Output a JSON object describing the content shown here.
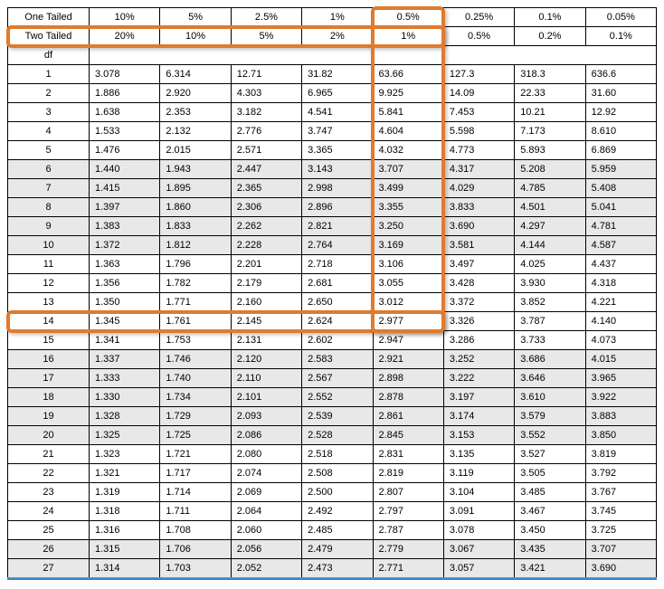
{
  "headers": {
    "one_tailed_label": "One Tailed",
    "two_tailed_label": "Two Tailed",
    "df_label": "df",
    "one_tailed": [
      "10%",
      "5%",
      "2.5%",
      "1%",
      "0.5%",
      "0.25%",
      "0.1%",
      "0.05%"
    ],
    "two_tailed": [
      "20%",
      "10%",
      "5%",
      "2%",
      "1%",
      "0.5%",
      "0.2%",
      "0.1%"
    ]
  },
  "rows": [
    {
      "df": "1",
      "v": [
        "3.078",
        "6.314",
        "12.71",
        "31.82",
        "63.66",
        "127.3",
        "318.3",
        "636.6"
      ]
    },
    {
      "df": "2",
      "v": [
        "1.886",
        "2.920",
        "4.303",
        "6.965",
        "9.925",
        "14.09",
        "22.33",
        "31.60"
      ]
    },
    {
      "df": "3",
      "v": [
        "1.638",
        "2.353",
        "3.182",
        "4.541",
        "5.841",
        "7.453",
        "10.21",
        "12.92"
      ]
    },
    {
      "df": "4",
      "v": [
        "1.533",
        "2.132",
        "2.776",
        "3.747",
        "4.604",
        "5.598",
        "7.173",
        "8.610"
      ]
    },
    {
      "df": "5",
      "v": [
        "1.476",
        "2.015",
        "2.571",
        "3.365",
        "4.032",
        "4.773",
        "5.893",
        "6.869"
      ]
    },
    {
      "df": "6",
      "v": [
        "1.440",
        "1.943",
        "2.447",
        "3.143",
        "3.707",
        "4.317",
        "5.208",
        "5.959"
      ],
      "shaded": true
    },
    {
      "df": "7",
      "v": [
        "1.415",
        "1.895",
        "2.365",
        "2.998",
        "3.499",
        "4.029",
        "4.785",
        "5.408"
      ],
      "shaded": true
    },
    {
      "df": "8",
      "v": [
        "1.397",
        "1.860",
        "2.306",
        "2.896",
        "3.355",
        "3.833",
        "4.501",
        "5.041"
      ],
      "shaded": true
    },
    {
      "df": "9",
      "v": [
        "1.383",
        "1.833",
        "2.262",
        "2.821",
        "3.250",
        "3.690",
        "4.297",
        "4.781"
      ],
      "shaded": true
    },
    {
      "df": "10",
      "v": [
        "1.372",
        "1.812",
        "2.228",
        "2.764",
        "3.169",
        "3.581",
        "4.144",
        "4.587"
      ],
      "shaded": true
    },
    {
      "df": "11",
      "v": [
        "1.363",
        "1.796",
        "2.201",
        "2.718",
        "3.106",
        "3.497",
        "4.025",
        "4.437"
      ]
    },
    {
      "df": "12",
      "v": [
        "1.356",
        "1.782",
        "2.179",
        "2.681",
        "3.055",
        "3.428",
        "3.930",
        "4.318"
      ]
    },
    {
      "df": "13",
      "v": [
        "1.350",
        "1.771",
        "2.160",
        "2.650",
        "3.012",
        "3.372",
        "3.852",
        "4.221"
      ]
    },
    {
      "df": "14",
      "v": [
        "1.345",
        "1.761",
        "2.145",
        "2.624",
        "2.977",
        "3.326",
        "3.787",
        "4.140"
      ]
    },
    {
      "df": "15",
      "v": [
        "1.341",
        "1.753",
        "2.131",
        "2.602",
        "2.947",
        "3.286",
        "3.733",
        "4.073"
      ]
    },
    {
      "df": "16",
      "v": [
        "1.337",
        "1.746",
        "2.120",
        "2.583",
        "2.921",
        "3.252",
        "3.686",
        "4.015"
      ],
      "shaded": true
    },
    {
      "df": "17",
      "v": [
        "1.333",
        "1.740",
        "2.110",
        "2.567",
        "2.898",
        "3.222",
        "3.646",
        "3.965"
      ],
      "shaded": true
    },
    {
      "df": "18",
      "v": [
        "1.330",
        "1.734",
        "2.101",
        "2.552",
        "2.878",
        "3.197",
        "3.610",
        "3.922"
      ],
      "shaded": true
    },
    {
      "df": "19",
      "v": [
        "1.328",
        "1.729",
        "2.093",
        "2.539",
        "2.861",
        "3.174",
        "3.579",
        "3.883"
      ],
      "shaded": true
    },
    {
      "df": "20",
      "v": [
        "1.325",
        "1.725",
        "2.086",
        "2.528",
        "2.845",
        "3.153",
        "3.552",
        "3.850"
      ],
      "shaded": true
    },
    {
      "df": "21",
      "v": [
        "1.323",
        "1.721",
        "2.080",
        "2.518",
        "2.831",
        "3.135",
        "3.527",
        "3.819"
      ]
    },
    {
      "df": "22",
      "v": [
        "1.321",
        "1.717",
        "2.074",
        "2.508",
        "2.819",
        "3.119",
        "3.505",
        "3.792"
      ]
    },
    {
      "df": "23",
      "v": [
        "1.319",
        "1.714",
        "2.069",
        "2.500",
        "2.807",
        "3.104",
        "3.485",
        "3.767"
      ]
    },
    {
      "df": "24",
      "v": [
        "1.318",
        "1.711",
        "2.064",
        "2.492",
        "2.797",
        "3.091",
        "3.467",
        "3.745"
      ]
    },
    {
      "df": "25",
      "v": [
        "1.316",
        "1.708",
        "2.060",
        "2.485",
        "2.787",
        "3.078",
        "3.450",
        "3.725"
      ]
    },
    {
      "df": "26",
      "v": [
        "1.315",
        "1.706",
        "2.056",
        "2.479",
        "2.779",
        "3.067",
        "3.435",
        "3.707"
      ],
      "shaded": true
    },
    {
      "df": "27",
      "v": [
        "1.314",
        "1.703",
        "2.052",
        "2.473",
        "2.771",
        "3.057",
        "3.421",
        "3.690"
      ],
      "shaded": true
    }
  ],
  "highlight": {
    "two_tailed_row": true,
    "df_row": 14,
    "col_index": 4
  },
  "chart_data": {
    "type": "table",
    "title": "Student's t-distribution critical values",
    "columns_one_tailed_alpha": [
      0.1,
      0.05,
      0.025,
      0.01,
      0.005,
      0.0025,
      0.001,
      0.0005
    ],
    "columns_two_tailed_alpha": [
      0.2,
      0.1,
      0.05,
      0.02,
      0.01,
      0.005,
      0.002,
      0.001
    ],
    "df": [
      1,
      2,
      3,
      4,
      5,
      6,
      7,
      8,
      9,
      10,
      11,
      12,
      13,
      14,
      15,
      16,
      17,
      18,
      19,
      20,
      21,
      22,
      23,
      24,
      25,
      26,
      27
    ],
    "values": [
      [
        3.078,
        6.314,
        12.71,
        31.82,
        63.66,
        127.3,
        318.3,
        636.6
      ],
      [
        1.886,
        2.92,
        4.303,
        6.965,
        9.925,
        14.09,
        22.33,
        31.6
      ],
      [
        1.638,
        2.353,
        3.182,
        4.541,
        5.841,
        7.453,
        10.21,
        12.92
      ],
      [
        1.533,
        2.132,
        2.776,
        3.747,
        4.604,
        5.598,
        7.173,
        8.61
      ],
      [
        1.476,
        2.015,
        2.571,
        3.365,
        4.032,
        4.773,
        5.893,
        6.869
      ],
      [
        1.44,
        1.943,
        2.447,
        3.143,
        3.707,
        4.317,
        5.208,
        5.959
      ],
      [
        1.415,
        1.895,
        2.365,
        2.998,
        3.499,
        4.029,
        4.785,
        5.408
      ],
      [
        1.397,
        1.86,
        2.306,
        2.896,
        3.355,
        3.833,
        4.501,
        5.041
      ],
      [
        1.383,
        1.833,
        2.262,
        2.821,
        3.25,
        3.69,
        4.297,
        4.781
      ],
      [
        1.372,
        1.812,
        2.228,
        2.764,
        3.169,
        3.581,
        4.144,
        4.587
      ],
      [
        1.363,
        1.796,
        2.201,
        2.718,
        3.106,
        3.497,
        4.025,
        4.437
      ],
      [
        1.356,
        1.782,
        2.179,
        2.681,
        3.055,
        3.428,
        3.93,
        4.318
      ],
      [
        1.35,
        1.771,
        2.16,
        2.65,
        3.012,
        3.372,
        3.852,
        4.221
      ],
      [
        1.345,
        1.761,
        2.145,
        2.624,
        2.977,
        3.326,
        3.787,
        4.14
      ],
      [
        1.341,
        1.753,
        2.131,
        2.602,
        2.947,
        3.286,
        3.733,
        4.073
      ],
      [
        1.337,
        1.746,
        2.12,
        2.583,
        2.921,
        3.252,
        3.686,
        4.015
      ],
      [
        1.333,
        1.74,
        2.11,
        2.567,
        2.898,
        3.222,
        3.646,
        3.965
      ],
      [
        1.33,
        1.734,
        2.101,
        2.552,
        2.878,
        3.197,
        3.61,
        3.922
      ],
      [
        1.328,
        1.729,
        2.093,
        2.539,
        2.861,
        3.174,
        3.579,
        3.883
      ],
      [
        1.325,
        1.725,
        2.086,
        2.528,
        2.845,
        3.153,
        3.552,
        3.85
      ],
      [
        1.323,
        1.721,
        2.08,
        2.518,
        2.831,
        3.135,
        3.527,
        3.819
      ],
      [
        1.321,
        1.717,
        2.074,
        2.508,
        2.819,
        3.119,
        3.505,
        3.792
      ],
      [
        1.319,
        1.714,
        2.069,
        2.5,
        2.807,
        3.104,
        3.485,
        3.767
      ],
      [
        1.318,
        1.711,
        2.064,
        2.492,
        2.797,
        3.091,
        3.467,
        3.745
      ],
      [
        1.316,
        1.708,
        2.06,
        2.485,
        2.787,
        3.078,
        3.45,
        3.725
      ],
      [
        1.315,
        1.706,
        2.056,
        2.479,
        2.779,
        3.067,
        3.435,
        3.707
      ],
      [
        1.314,
        1.703,
        2.052,
        2.473,
        2.771,
        3.057,
        3.421,
        3.69
      ]
    ],
    "highlighted_cell": {
      "df": 14,
      "two_tailed_alpha": 0.01,
      "value": 2.977
    }
  }
}
